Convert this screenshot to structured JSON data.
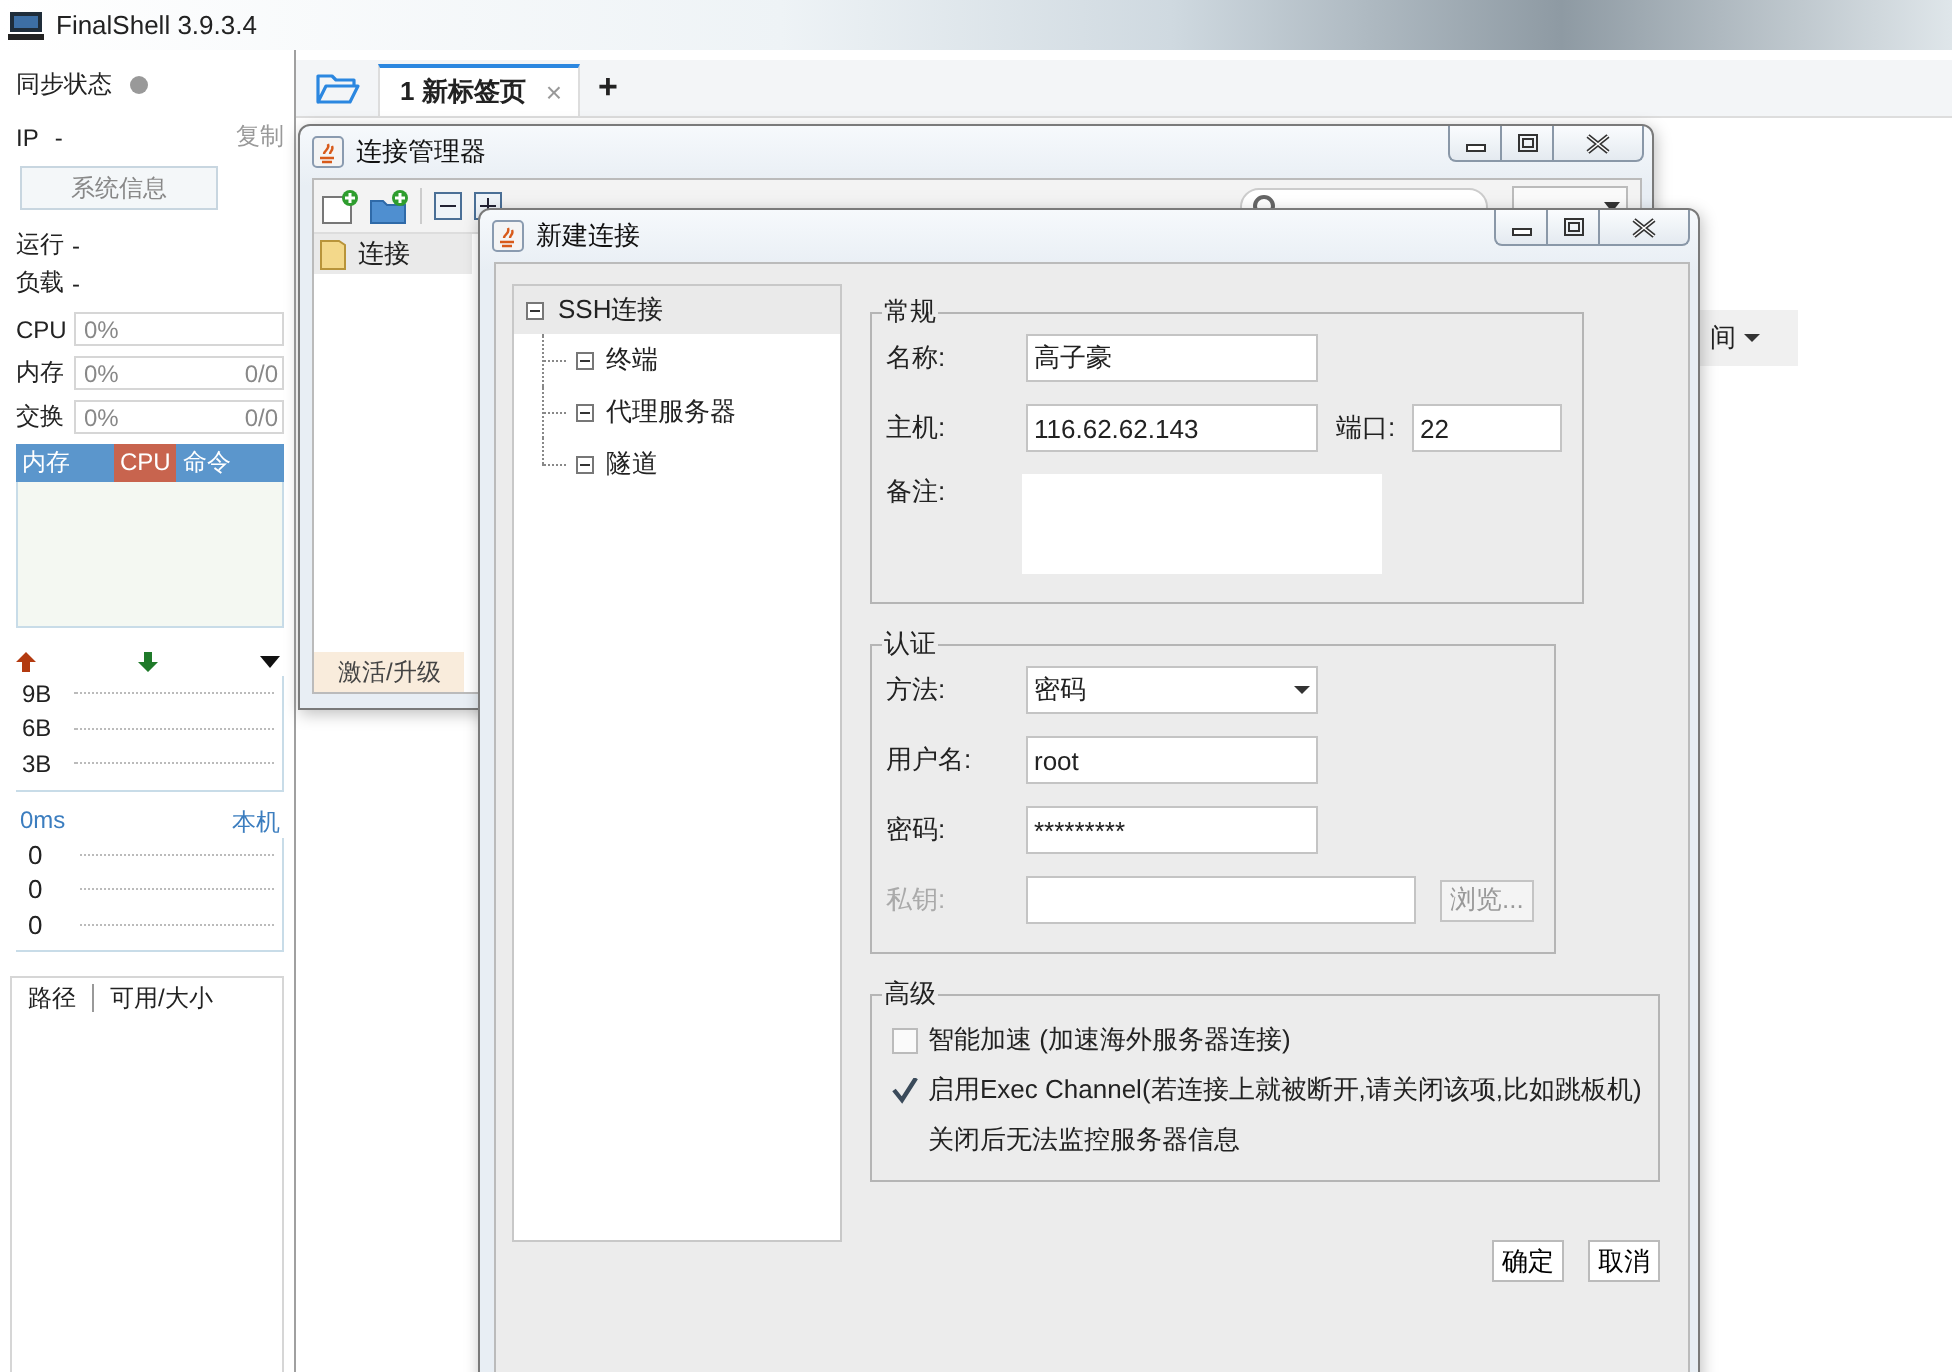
{
  "app": {
    "title": "FinalShell 3.9.3.4"
  },
  "sidebar": {
    "sync_label": "同步状态",
    "ip_label": "IP",
    "ip_value": "-",
    "copy_link": "复制",
    "sysinfo_button": "系统信息",
    "uptime_label": "运行",
    "uptime_value": "-",
    "load_label": "负载",
    "load_value": "-",
    "meters": [
      {
        "label": "CPU",
        "percent": "0%"
      },
      {
        "label": "内存",
        "percent": "0%",
        "amount": "0/0"
      },
      {
        "label": "交换",
        "percent": "0%",
        "amount": "0/0"
      }
    ],
    "tabs": [
      {
        "label": "内存",
        "selected": false
      },
      {
        "label": "CPU",
        "selected": true
      },
      {
        "label": "命令",
        "selected": false
      }
    ],
    "traffic_ticks": [
      "9B",
      "6B",
      "3B"
    ],
    "ping": {
      "latency": "0ms",
      "host": "本机",
      "ticks": [
        "0",
        "0",
        "0"
      ]
    },
    "disk_table": {
      "columns": [
        "路径",
        "可用/大小"
      ]
    }
  },
  "tabs": [
    {
      "label": "1 新标签页",
      "selected": true,
      "close": "×"
    }
  ],
  "new_tab": "+",
  "background_column": {
    "label": "间"
  },
  "connection_manager": {
    "title": "连接管理器",
    "tree": [
      {
        "label": "连接",
        "selected": true
      }
    ],
    "upgrade_button": "激活/升级"
  },
  "new_connection": {
    "title": "新建连接",
    "nav": [
      {
        "label": "SSH连接",
        "selected": true,
        "expanded": true,
        "children": [
          {
            "label": "终端",
            "selected": false,
            "expanded": true
          },
          {
            "label": "代理服务器",
            "selected": false,
            "expanded": true
          },
          {
            "label": "隧道",
            "selected": false,
            "expanded": true
          }
        ]
      }
    ],
    "groups": [
      {
        "title": "常规",
        "fields": [
          {
            "kind": "text",
            "label": "名称:",
            "value": "高子豪"
          },
          {
            "kind": "text",
            "label": "主机:",
            "value": "116.62.62.143",
            "extra": {
              "label": "端口:",
              "value": "22"
            }
          },
          {
            "kind": "textarea",
            "label": "备注:"
          }
        ]
      },
      {
        "title": "认证",
        "fields": [
          {
            "kind": "select",
            "label": "方法:",
            "value": "密码"
          },
          {
            "kind": "text",
            "label": "用户名:",
            "value": "root"
          },
          {
            "kind": "password",
            "label": "密码:",
            "value": "*********"
          },
          {
            "kind": "file",
            "label": "私钥:",
            "disabled": true,
            "button": "浏览..."
          }
        ]
      },
      {
        "title": "高级",
        "options": [
          {
            "label": "智能加速 (加速海外服务器连接)",
            "checked": false
          },
          {
            "label": "启用Exec Channel(若连接上就被断开,请关闭该项,比如跳板机)",
            "checked": true,
            "note": "关闭后无法监控服务器信息"
          }
        ]
      }
    ],
    "buttons": [
      "确定",
      "取消"
    ]
  }
}
